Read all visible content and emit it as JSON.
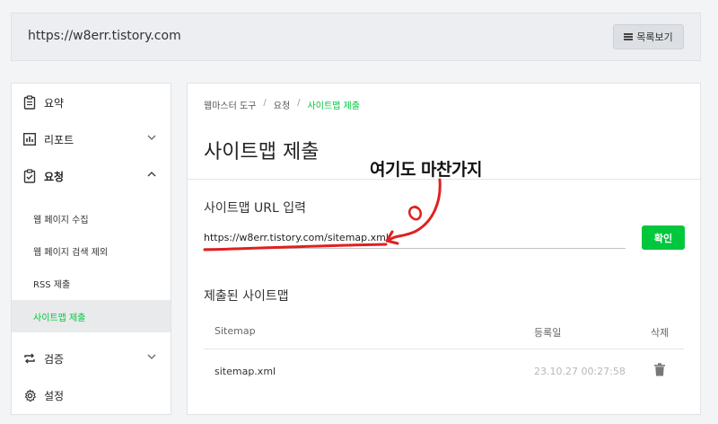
{
  "header": {
    "site_url": "https://w8err.tistory.com",
    "list_button_label": "목록보기"
  },
  "sidebar": {
    "items": [
      {
        "label": "요약",
        "icon": "clipboard-icon"
      },
      {
        "label": "리포트",
        "icon": "bar-chart-icon"
      },
      {
        "label": "요청",
        "icon": "clipboard-check-icon"
      },
      {
        "label": "검증",
        "icon": "repeat-icon"
      },
      {
        "label": "설정",
        "icon": "gear-icon"
      }
    ],
    "sub_items": [
      {
        "label": "웹 페이지 수집"
      },
      {
        "label": "웹 페이지 검색 제외"
      },
      {
        "label": "RSS 제출"
      },
      {
        "label": "사이트맵 제출",
        "active": true
      }
    ]
  },
  "breadcrumb": {
    "items": [
      "웹마스터 도구",
      "요청",
      "사이트맵 제출"
    ],
    "separator": "/"
  },
  "main": {
    "page_title": "사이트맵 제출",
    "input_section_title": "사이트맵 URL 입력",
    "sitemap_url_value": "https://w8err.tistory.com/sitemap.xml",
    "confirm_label": "확인",
    "submitted_title": "제출된 사이트맵",
    "table": {
      "headers": [
        "Sitemap",
        "등록일",
        "삭제"
      ],
      "rows": [
        {
          "sitemap": "sitemap.xml",
          "date": "23.10.27 00:27:58"
        }
      ]
    }
  },
  "annotation": {
    "text": "여기도 마찬가지",
    "color": "#e02020"
  },
  "colors": {
    "accent": "#00c73c"
  }
}
